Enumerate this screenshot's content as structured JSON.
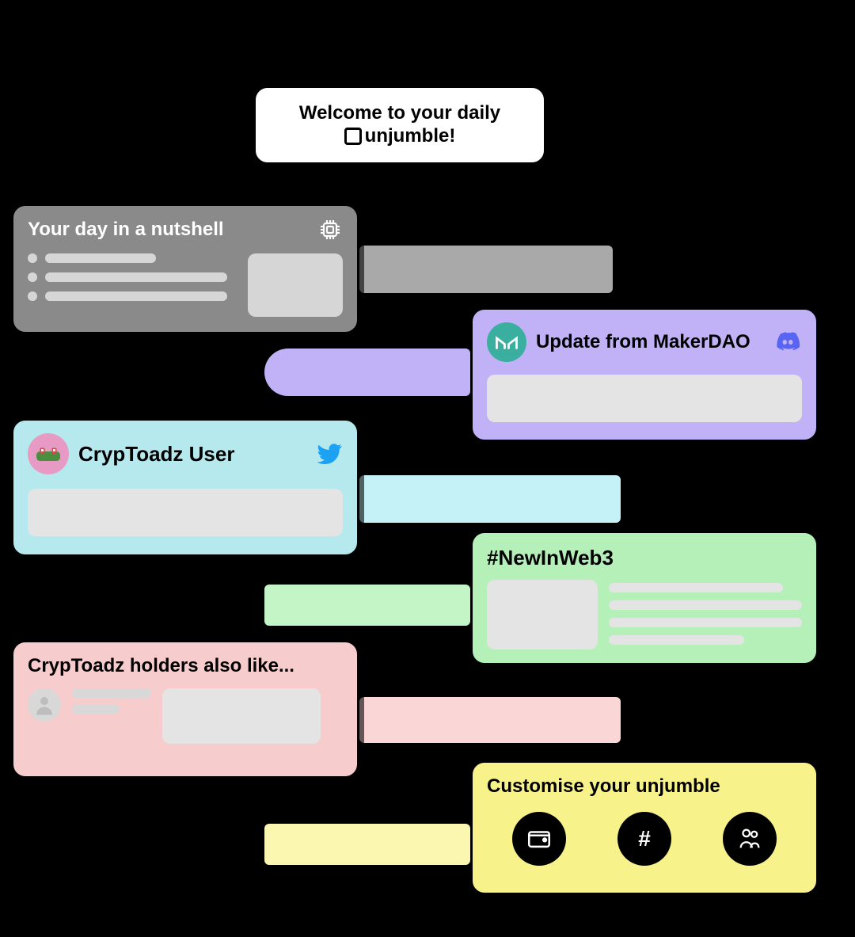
{
  "welcome": {
    "line1": "Welcome to your daily",
    "brand": "unjumble!"
  },
  "nutshell": {
    "title": "Your day in a nutshell",
    "icon": "chip-icon"
  },
  "maker": {
    "title": "Update from MakerDAO",
    "logo": "maker-logo",
    "platform": "discord-icon"
  },
  "toadz": {
    "title": "CrypToadz User",
    "avatar": "cryptoadz-avatar",
    "platform": "twitter-icon"
  },
  "web3": {
    "title": "#NewInWeb3"
  },
  "holders": {
    "title": "CrypToadz holders also like..."
  },
  "custom": {
    "title": "Customise your unjumble",
    "options": [
      {
        "name": "wallet-icon"
      },
      {
        "name": "hashtag-icon",
        "glyph": "#"
      },
      {
        "name": "people-icon"
      }
    ]
  }
}
